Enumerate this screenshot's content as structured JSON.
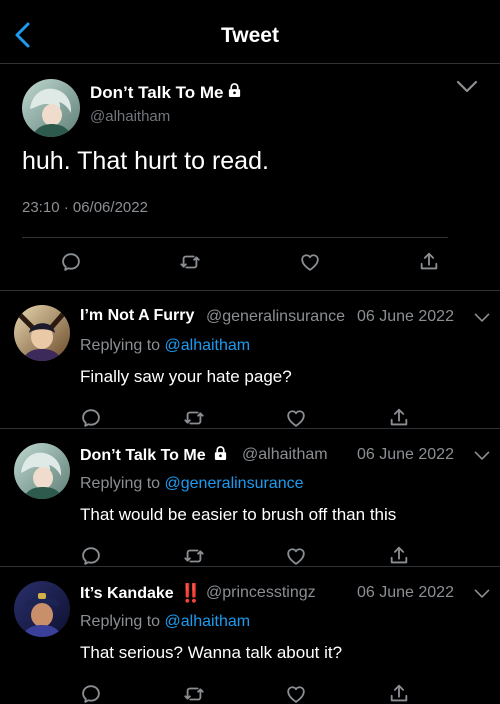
{
  "header": {
    "title": "Tweet",
    "back_icon": "chevron-left-icon"
  },
  "colors": {
    "background": "#000000",
    "accent": "#1d9bf0",
    "muted": "#8b8f93",
    "divider": "#2f3336"
  },
  "main_tweet": {
    "display_name": "Don’t Talk To Me",
    "handle": "@alhaitham",
    "text": "huh. That hurt to read.",
    "timestamp": "23:10 · 06/06/2022",
    "icons": [
      "lock-icon",
      "chevron-down-icon",
      "reply-icon",
      "retweet-icon",
      "like-icon",
      "share-icon"
    ]
  },
  "replies": [
    {
      "display_name": "I’m Not A Furry",
      "handle": "@generalinsurance",
      "date": "06 June 2022",
      "replying_to_prefix": "Replying to",
      "replying_to": "@alhaitham",
      "text": "Finally saw your hate page?"
    },
    {
      "display_name": "Don’t Talk To Me",
      "handle": "@alhaitham",
      "date": "06 June 2022",
      "replying_to_prefix": "Replying to",
      "replying_to": "@generalinsurance",
      "text": "That would be easier to brush off than this"
    },
    {
      "display_name": "It’s Kandake",
      "name_badge": "‼️",
      "handle": "@princesstingz",
      "date": "06 June 2022",
      "replying_to_prefix": "Replying to",
      "replying_to": "@alhaitham",
      "text": "That serious? Wanna talk about it?"
    }
  ]
}
